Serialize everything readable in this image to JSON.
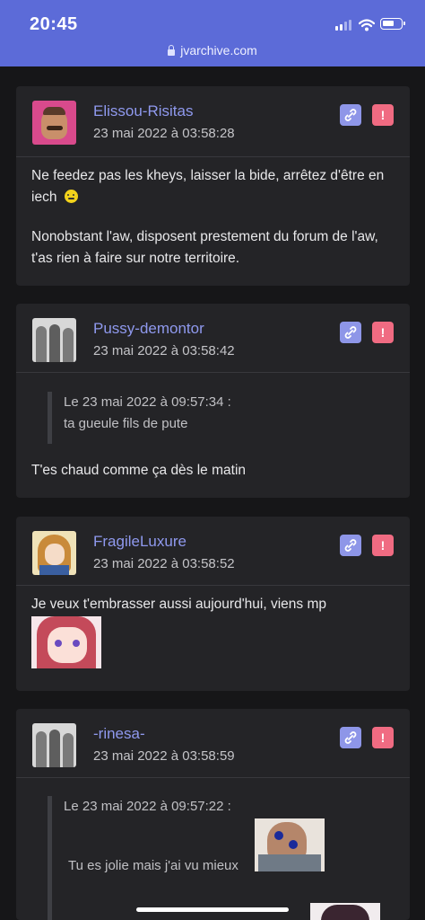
{
  "status": {
    "time": "20:45",
    "url": "jvarchive.com"
  },
  "posts": [
    {
      "author": "Elissou-Risitas",
      "date": "23 mai 2022 à 03:58:28",
      "paragraph1": "Ne feedez pas les kheys, laisser la bide, arrêtez d'être en iech",
      "paragraph2": "Nonobstant l'aw, disposent prestement du forum de l'aw, t'as rien à faire sur notre territoire."
    },
    {
      "author": "Pussy-demontor",
      "date": "23 mai 2022 à 03:58:42",
      "quote_header": "Le 23 mai 2022 à 09:57:34 :",
      "quote_text": "ta gueule fils de pute",
      "body": "T'es chaud comme ça dès le matin"
    },
    {
      "author": "FragileLuxure",
      "date": "23 mai 2022 à 03:58:52",
      "body": "Je veux t'embrasser aussi aujourd'hui, viens mp"
    },
    {
      "author": "-rinesa-",
      "date": "23 mai 2022 à 03:58:59",
      "quote_header": "Le 23 mai 2022 à 09:57:22 :",
      "quote_text": "Tu es jolie mais j'ai vu mieux"
    }
  ],
  "buttons": {
    "alert_label": "!"
  },
  "colors": {
    "accent": "#5c6bd8",
    "pseudo": "#8f99ee",
    "link_btn": "#8e96e8",
    "alert_btn": "#f06b82",
    "card": "#242427",
    "background": "#161618"
  }
}
